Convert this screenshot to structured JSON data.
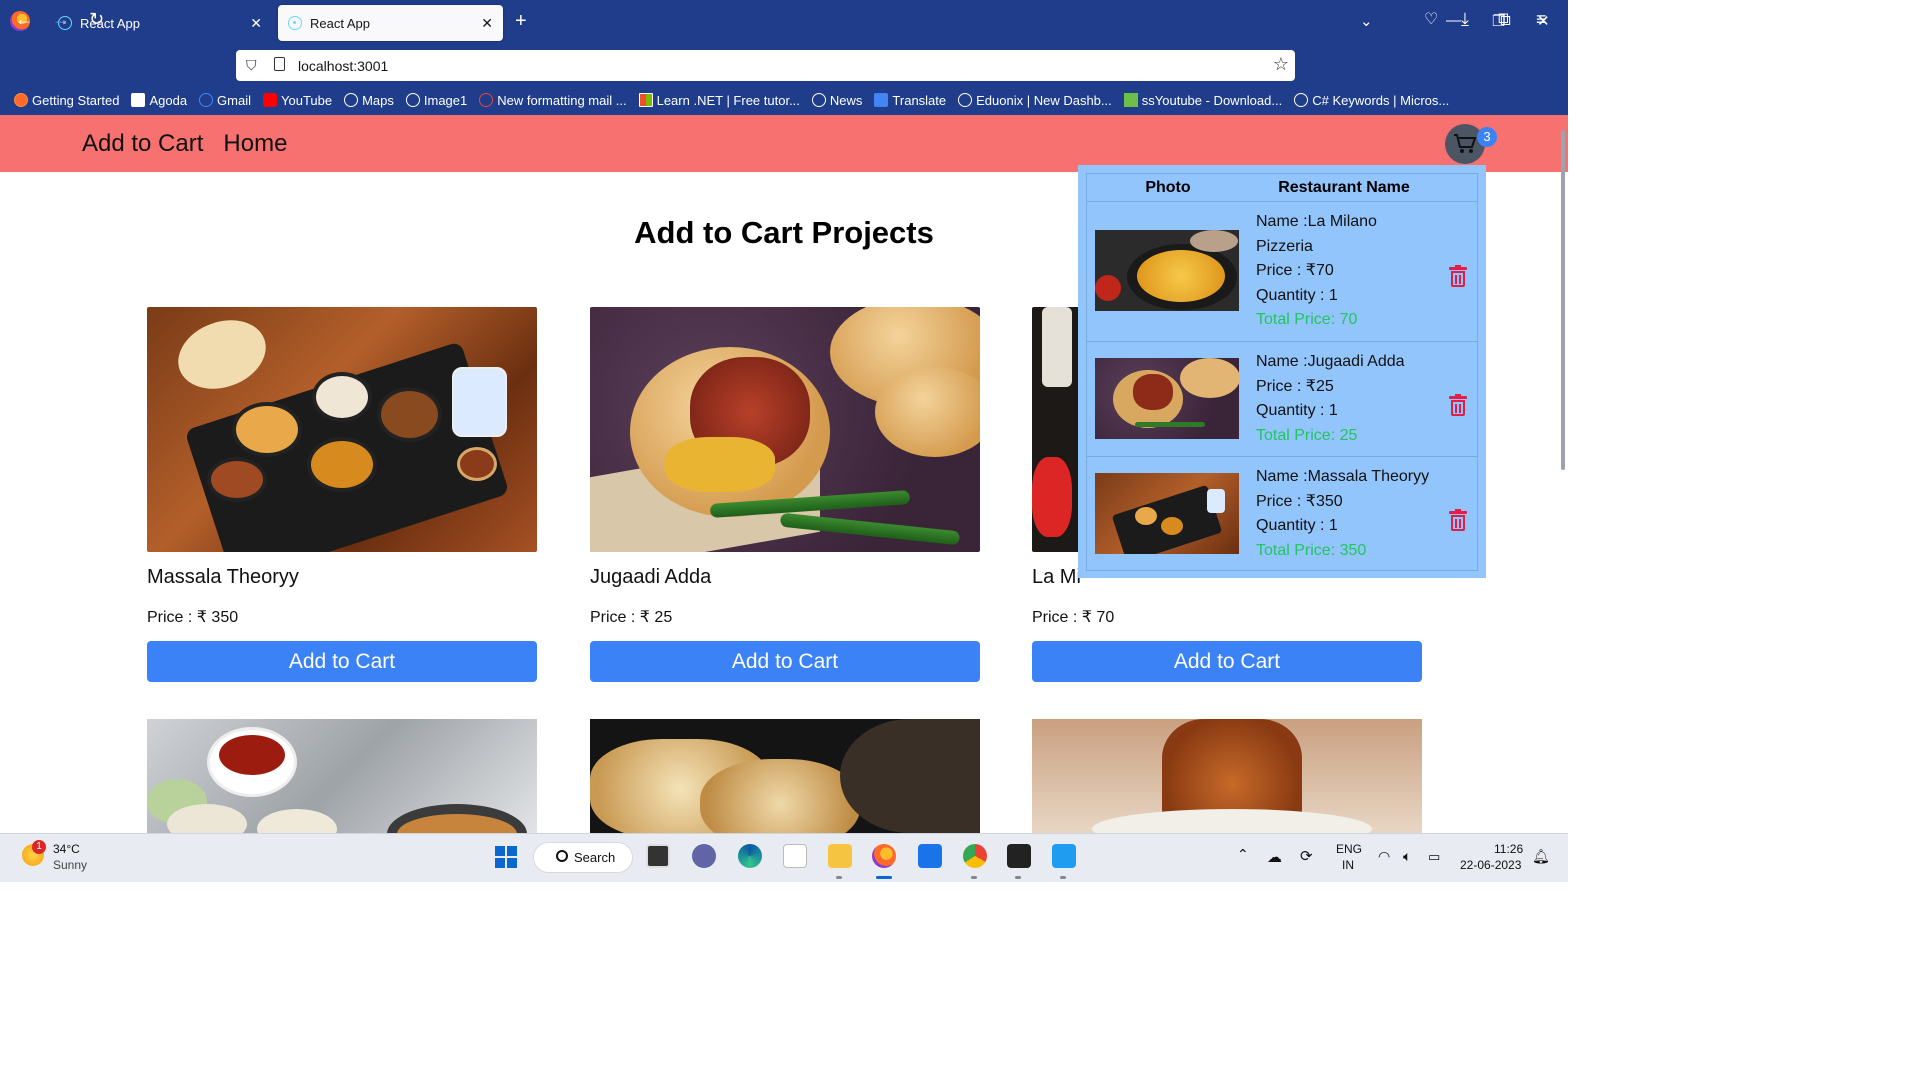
{
  "browser": {
    "tabs": [
      {
        "label": "React App"
      },
      {
        "label": "React App"
      }
    ],
    "url": "localhost:3001",
    "bookmarks": [
      "Getting Started",
      "Agoda",
      "Gmail",
      "YouTube",
      "Maps",
      "Image1",
      "New formatting mail ...",
      "Learn .NET | Free tutor...",
      "News",
      "Translate",
      "Eduonix | New Dashb...",
      "ssYoutube - Download...",
      "C# Keywords | Micros..."
    ]
  },
  "app": {
    "nav": {
      "brand": "Add to Cart",
      "home": "Home"
    },
    "cart_count": "3",
    "page_title": "Add to Cart Projects",
    "products": [
      {
        "name": "Massala Theoryy",
        "price": "Price : ₹ 350",
        "button": "Add to Cart"
      },
      {
        "name": "Jugaadi Adda",
        "price": "Price : ₹ 25",
        "button": "Add to Cart"
      },
      {
        "name": "La Mi",
        "price": "Price : ₹ 70",
        "button": "Add to Cart"
      }
    ],
    "cart": {
      "headers": {
        "photo": "Photo",
        "name": "Restaurant Name"
      },
      "items": [
        {
          "name_line1": "Name :La Milano",
          "name_line2": "Pizzeria",
          "price": "Price : ₹70",
          "quantity": "Quantity : 1",
          "total": "Total Price: 70"
        },
        {
          "name_line1": "Name :Jugaadi Adda",
          "price": "Price : ₹25",
          "quantity": "Quantity : 1",
          "total": "Total Price: 25"
        },
        {
          "name_line1": "Name :Massala Theoryy",
          "price": "Price : ₹350",
          "quantity": "Quantity : 1",
          "total": "Total Price: 350"
        }
      ]
    }
  },
  "taskbar": {
    "weather_badge": "1",
    "temp": "34°C",
    "condition": "Sunny",
    "search": "Search",
    "lang1": "ENG",
    "lang2": "IN",
    "time": "11:26",
    "date": "22-06-2023"
  }
}
